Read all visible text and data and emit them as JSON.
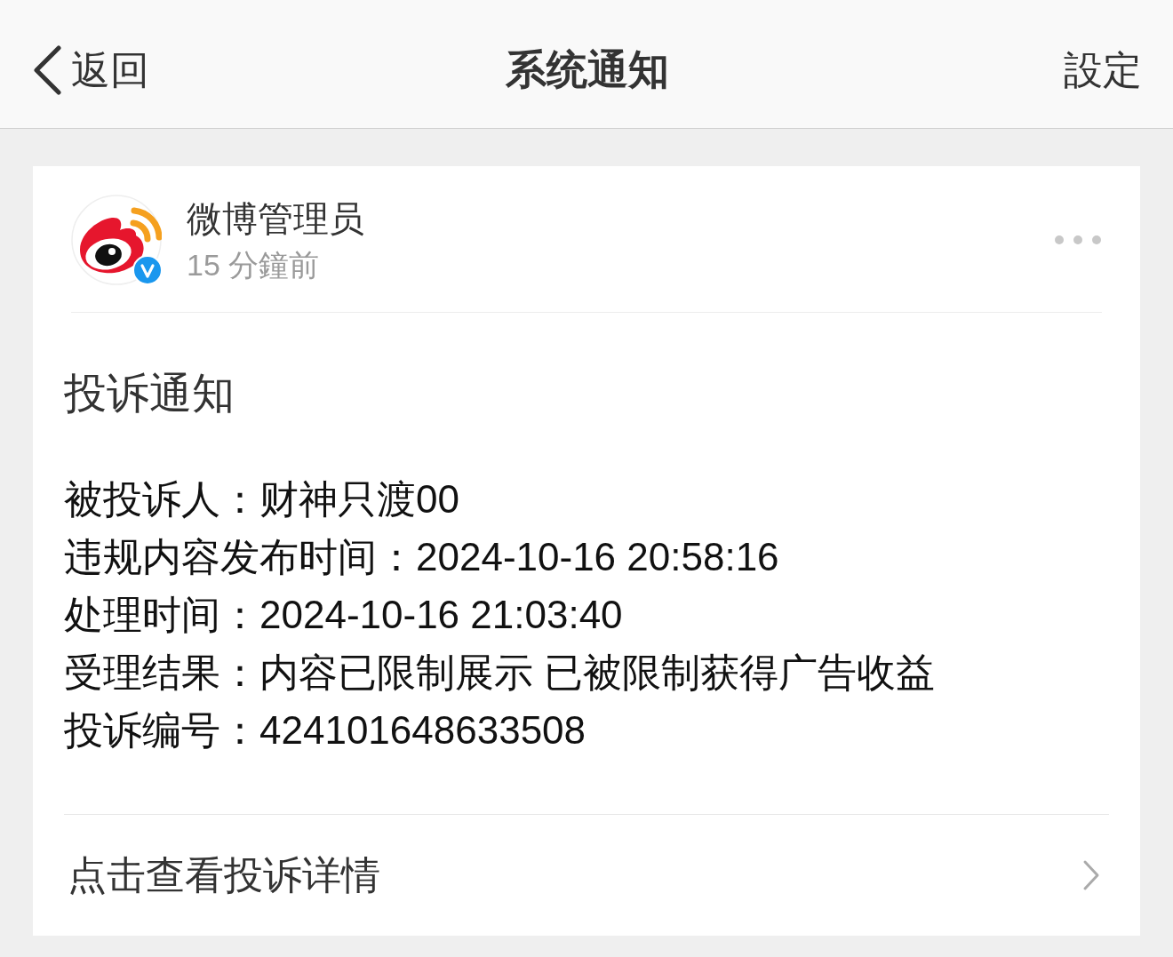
{
  "nav": {
    "back_label": "返回",
    "title": "系统通知",
    "settings_label": "設定"
  },
  "notification": {
    "sender": {
      "name": "微博管理员",
      "time": "15 分鐘前",
      "verified": true
    },
    "title": "投诉通知",
    "lines": [
      "被投诉人：财神只渡00",
      "违规内容发布时间：2024-10-16 20:58:16",
      "处理时间：2024-10-16 21:03:40",
      "受理结果：内容已限制展示 已被限制获得广告收益",
      "投诉编号：424101648633508"
    ],
    "link": {
      "label": "点击查看投诉详情"
    }
  }
}
